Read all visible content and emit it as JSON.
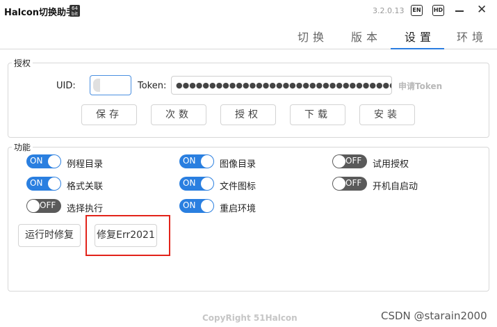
{
  "titlebar": {
    "title": "Halcon切换助手",
    "bit_badge": "64 bit",
    "version": "3.2.0.13",
    "en_label": "EN",
    "hd_label": "HD",
    "close_glyph": "✕"
  },
  "tabs": [
    {
      "label": "切换",
      "active": false
    },
    {
      "label": "版本",
      "active": false
    },
    {
      "label": "设置",
      "active": true
    },
    {
      "label": "环境",
      "active": false
    }
  ],
  "auth": {
    "group_title": "授权",
    "uid_label": "UID:",
    "uid_value": "",
    "token_label": "Token:",
    "token_value": "●●●●●●●●●●●●●●●●●●●●●●●●●●●●●●●●●●●●●●●●●●●●",
    "apply_token": "申请Token",
    "buttons": [
      "保存",
      "次数",
      "授权",
      "下载",
      "安装"
    ]
  },
  "func": {
    "group_title": "功能",
    "switches": [
      {
        "label": "例程目录",
        "state": "ON"
      },
      {
        "label": "图像目录",
        "state": "ON"
      },
      {
        "label": "试用授权",
        "state": "OFF"
      },
      {
        "label": "格式关联",
        "state": "ON"
      },
      {
        "label": "文件图标",
        "state": "ON"
      },
      {
        "label": "开机自启动",
        "state": "OFF"
      },
      {
        "label": "选择执行",
        "state": "OFF"
      },
      {
        "label": "重启环境",
        "state": "ON"
      }
    ],
    "runtime_fix": "运行时修复",
    "fix_err": "修复Err2021"
  },
  "footer": "CopyRight 51Halcon",
  "watermark": "CSDN @starain2000",
  "colors": {
    "accent": "#2a7fe0",
    "switch_off": "#5a5a5a",
    "highlight": "#e2231a"
  }
}
